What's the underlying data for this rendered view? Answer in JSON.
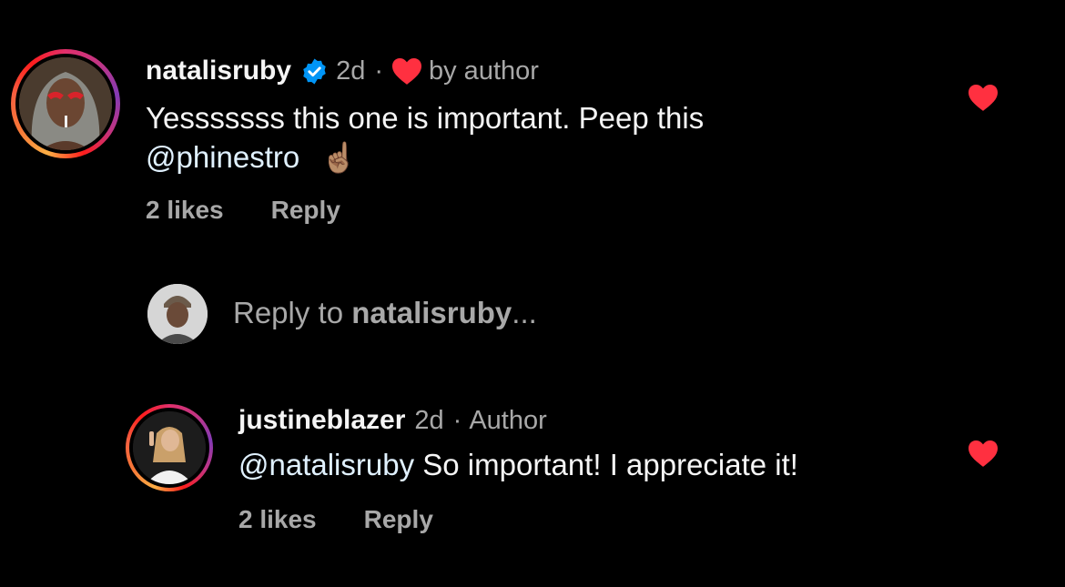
{
  "comment1": {
    "username": "natalisruby",
    "time": "2d",
    "dot": "·",
    "author_like_label": "by author",
    "text_line1": "Yesssssss this one is important. Peep this",
    "mention": "@phinestro",
    "emoji": "☝🏽",
    "likes": "2 likes",
    "reply_label": "Reply"
  },
  "reply_box": {
    "prefix": "Reply to ",
    "target": "natalisruby",
    "suffix": "..."
  },
  "comment2": {
    "username": "justineblazer",
    "time": "2d",
    "dot": "·",
    "badge": "Author",
    "mention": "@natalisruby",
    "text": " So important! I appreciate it!",
    "likes": "2 likes",
    "reply_label": "Reply"
  },
  "colors": {
    "background": "#000000",
    "heart": "#ff3040",
    "verified": "#0095f6",
    "muted_text": "#a8a8a8",
    "mention": "#e0f1ff"
  },
  "icons": {
    "verified": "verified-badge-icon",
    "heart": "heart-icon"
  }
}
